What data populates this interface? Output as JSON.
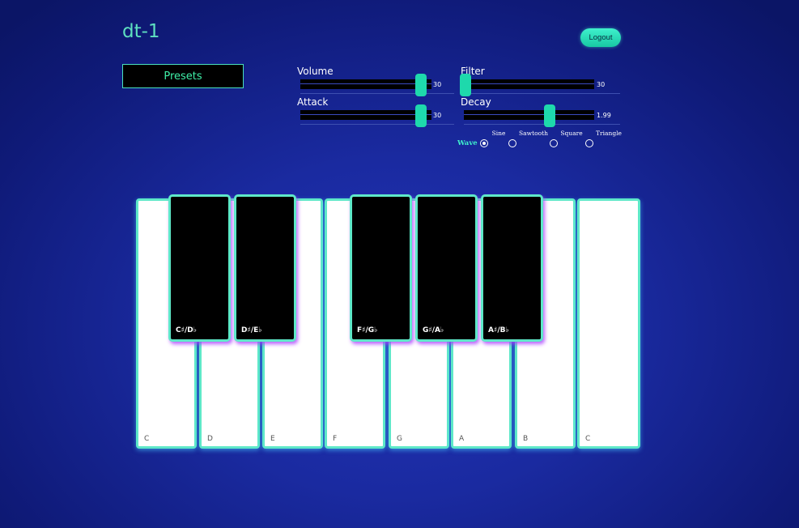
{
  "app": {
    "title": "dt-1"
  },
  "header": {
    "logout_label": "Logout"
  },
  "presets": {
    "label": "Presets"
  },
  "controls": {
    "volume": {
      "label": "Volume",
      "value": "30",
      "fraction": 0.92
    },
    "filter": {
      "label": "Filter",
      "value": "30",
      "fraction": 0.01
    },
    "attack": {
      "label": "Attack",
      "value": "30",
      "fraction": 0.92
    },
    "decay": {
      "label": "Decay",
      "value": "1.99",
      "fraction": 0.66
    }
  },
  "wave": {
    "label": "Wave",
    "options": [
      "Sine",
      "Sawtooth",
      "Square",
      "Triangle"
    ],
    "selected": "Sine"
  },
  "keyboard": {
    "white_keys": [
      "C",
      "D",
      "E",
      "F",
      "G",
      "A",
      "B",
      "C"
    ],
    "black_keys": [
      "C♯/D♭",
      "D♯/E♭",
      "F♯/G♭",
      "G♯/A♭",
      "A♯/B♭"
    ]
  },
  "colors": {
    "accent": "#1ed9ac",
    "key_border": "#5ee8c8",
    "background": "#1a2aa0"
  }
}
